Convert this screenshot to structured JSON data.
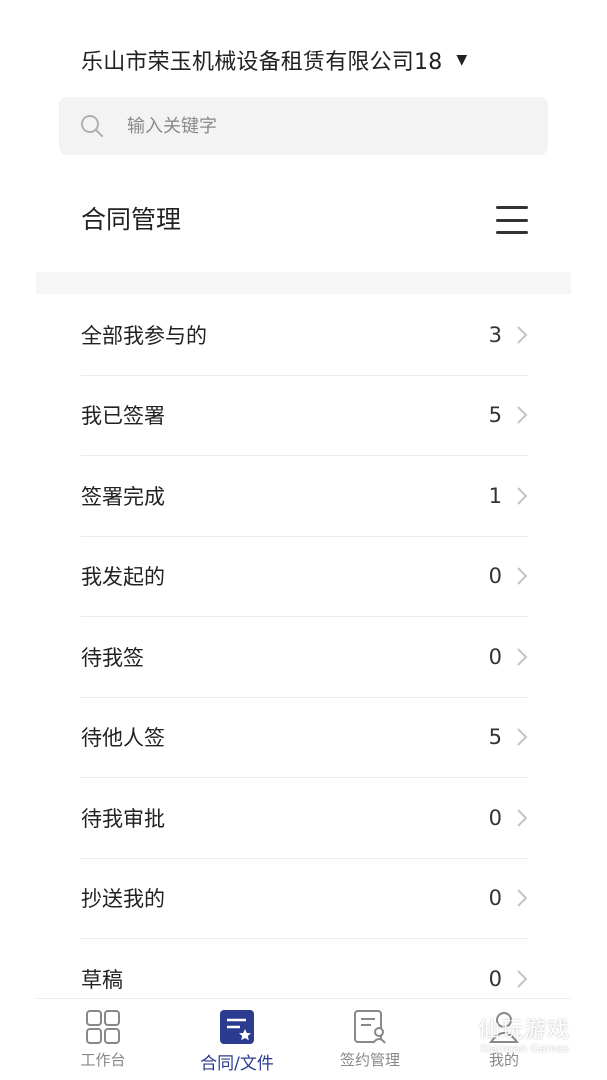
{
  "header": {
    "company_name": "乐山市荣玉机械设备租赁有限公司18",
    "dropdown_caret": "▼"
  },
  "search": {
    "placeholder": "输入关键字",
    "value": ""
  },
  "section": {
    "title": "合同管理"
  },
  "list": {
    "items": [
      {
        "label": "全部我参与的",
        "count": "3"
      },
      {
        "label": "我已签署",
        "count": "5"
      },
      {
        "label": "签署完成",
        "count": "1"
      },
      {
        "label": "我发起的",
        "count": "0"
      },
      {
        "label": "待我签",
        "count": "0"
      },
      {
        "label": "待他人签",
        "count": "5"
      },
      {
        "label": "待我审批",
        "count": "0"
      },
      {
        "label": "抄送我的",
        "count": "0"
      },
      {
        "label": "草稿",
        "count": "0"
      }
    ]
  },
  "tabbar": {
    "tabs": [
      {
        "label": "工作台",
        "icon": "grid-icon",
        "active": false
      },
      {
        "label": "合同/文件",
        "icon": "contract-star-icon",
        "active": true
      },
      {
        "label": "签约管理",
        "icon": "sign-manage-icon",
        "active": false
      },
      {
        "label": "我的",
        "icon": "person-icon",
        "active": false
      }
    ]
  },
  "watermark": {
    "main": "仙玩游戏",
    "sub": "Xianwan Games"
  },
  "colors": {
    "accent": "#2b3b8f",
    "text": "#222222",
    "muted": "#888888",
    "search_bg": "#f3f3f3",
    "divider": "#ececec"
  }
}
